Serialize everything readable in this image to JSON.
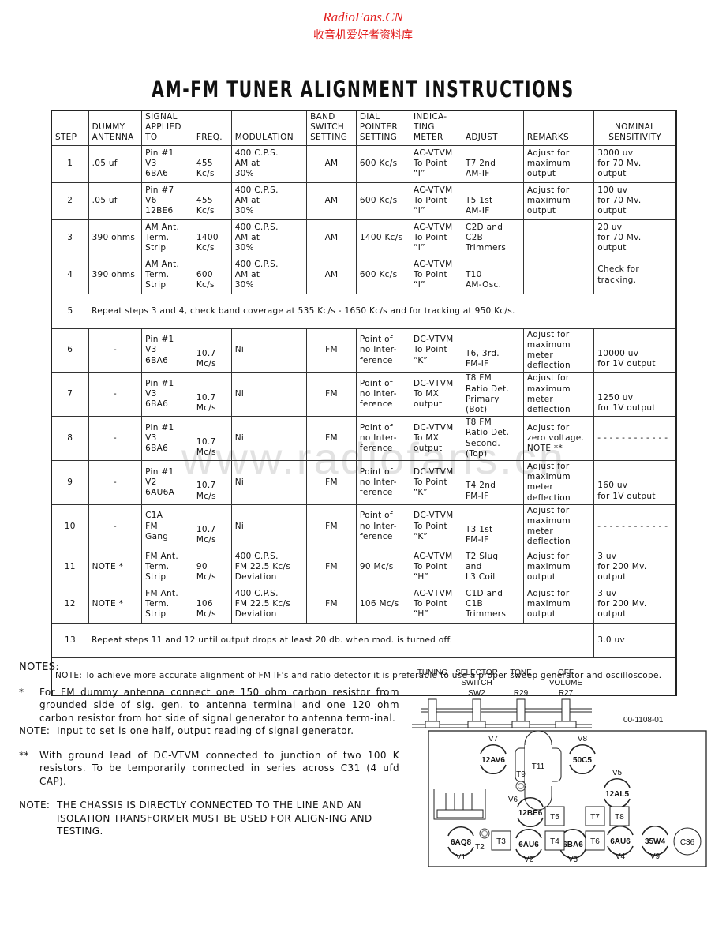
{
  "watermark": {
    "site": "RadioFans.CN",
    "subtitle": "收音机爱好者资料库",
    "background": "www.radiofans.cn",
    "color": "#e21b1b"
  },
  "title": "AM-FM TUNER ALIGNMENT INSTRUCTIONS",
  "table": {
    "headers": [
      "STEP",
      "DUMMY ANTENNA",
      "SIGNAL APPLIED TO",
      "FREQ.",
      "MODULATION",
      "BAND SWITCH SETTING",
      "DIAL POINTER SETTING",
      "INDICA-TING METER",
      "ADJUST",
      "REMARKS",
      "NOMINAL SENSITIVITY"
    ],
    "header_lines": [
      [
        "STEP"
      ],
      [
        "DUMMY",
        "ANTENNA"
      ],
      [
        "SIGNAL",
        "APPLIED",
        "TO"
      ],
      [
        "FREQ."
      ],
      [
        "MODULATION"
      ],
      [
        "BAND",
        "SWITCH",
        "SETTING"
      ],
      [
        "DIAL",
        "POINTER",
        "SETTING"
      ],
      [
        "INDICA-",
        "TING",
        "METER"
      ],
      [
        "ADJUST"
      ],
      [
        "REMARKS"
      ],
      [
        "NOMINAL",
        "SENSITIVITY"
      ]
    ],
    "rows": [
      {
        "step": "1",
        "antenna": ".05 uf",
        "signal": [
          "Pin #1",
          "V3",
          "6BA6"
        ],
        "freq": [
          "455",
          "Kc/s"
        ],
        "modulation": [
          "400 C.P.S.",
          "AM at",
          "30%"
        ],
        "band": "AM",
        "dial": "600 Kc/s",
        "meter": [
          "AC-VTVM",
          "To Point",
          "“I”"
        ],
        "adjust": [
          "T7 2nd",
          "AM-IF"
        ],
        "remarks": [
          "Adjust for",
          "maximum output"
        ],
        "sensitivity": [
          "3000 uv",
          "for 70 Mv. output"
        ]
      },
      {
        "step": "2",
        "antenna": ".05 uf",
        "signal": [
          "Pin #7",
          "V6",
          "12BE6"
        ],
        "freq": [
          "455",
          "Kc/s"
        ],
        "modulation": [
          "400 C.P.S.",
          "AM at",
          "30%"
        ],
        "band": "AM",
        "dial": "600 Kc/s",
        "meter": [
          "AC-VTVM",
          "To Point",
          "“I”"
        ],
        "adjust": [
          "T5 1st",
          "AM-IF"
        ],
        "remarks": [
          "Adjust for",
          "maximum output"
        ],
        "sensitivity": [
          "100 uv",
          "for 70 Mv. output"
        ]
      },
      {
        "step": "3",
        "antenna": "390 ohms",
        "signal": [
          "AM Ant.",
          "Term.",
          "Strip"
        ],
        "freq": [
          "1400",
          "Kc/s"
        ],
        "modulation": [
          "400 C.P.S.",
          "AM at",
          "30%"
        ],
        "band": "AM",
        "dial": "1400 Kc/s",
        "meter": [
          "AC-VTVM",
          "To Point",
          "“I”"
        ],
        "adjust": [
          "C2D and C2B",
          "Trimmers"
        ],
        "remarks": [],
        "sensitivity": [
          "20 uv",
          "for 70 Mv. output"
        ]
      },
      {
        "step": "4",
        "antenna": "390 ohms",
        "signal": [
          "AM Ant.",
          "Term.",
          "Strip"
        ],
        "freq": [
          "600",
          "Kc/s"
        ],
        "modulation": [
          "400 C.P.S.",
          "AM at",
          "30%"
        ],
        "band": "AM",
        "dial": "600 Kc/s",
        "meter": [
          "AC-VTVM",
          "To Point",
          "“I”"
        ],
        "adjust": [
          "T10",
          "AM-Osc."
        ],
        "remarks": [],
        "sensitivity": [
          "Check for tracking."
        ]
      },
      {
        "step": "5",
        "span_text": "Repeat steps 3 and 4, check band coverage at 535 Kc/s - 1650 Kc/s and for tracking at 950 Kc/s."
      },
      {
        "step": "6",
        "antenna": "-",
        "signal": [
          "Pin #1",
          "V3",
          "6BA6"
        ],
        "freq": [
          "10.7",
          "Mc/s"
        ],
        "modulation": [
          "Nil"
        ],
        "band": "FM",
        "dial": [
          "Point of",
          "no Inter-",
          "ference"
        ],
        "meter": [
          "DC-VTVM",
          "To Point",
          "“K”"
        ],
        "adjust": [
          "T6, 3rd.",
          "FM-IF"
        ],
        "remarks": [
          "Adjust for",
          "maximum meter",
          "deflection"
        ],
        "sensitivity": [
          "10000 uv",
          "for 1V output"
        ]
      },
      {
        "step": "7",
        "antenna": "-",
        "signal": [
          "Pin #1",
          "V3",
          "6BA6"
        ],
        "freq": [
          "10.7",
          "Mc/s"
        ],
        "modulation": [
          "Nil"
        ],
        "band": "FM",
        "dial": [
          "Point of",
          "no Inter-",
          "ference"
        ],
        "meter": [
          "DC-VTVM",
          "To MX",
          "output"
        ],
        "adjust": [
          "T8 FM",
          "Ratio Det.",
          "Primary (Bot)"
        ],
        "remarks": [
          "Adjust for",
          "maximum meter",
          "deflection"
        ],
        "sensitivity": [
          "1250 uv",
          "for 1V output"
        ]
      },
      {
        "step": "8",
        "antenna": "-",
        "signal": [
          "Pin #1",
          "V3",
          "6BA6"
        ],
        "freq": [
          "10.7",
          "Mc/s"
        ],
        "modulation": [
          "Nil"
        ],
        "band": "FM",
        "dial": [
          "Point of",
          "no Inter-",
          "ference"
        ],
        "meter": [
          "DC-VTVM",
          "To MX",
          "output"
        ],
        "adjust": [
          "T8 FM",
          "Ratio Det.",
          "Second. (Top)"
        ],
        "remarks": [
          "Adjust for",
          "zero voltage.",
          "NOTE **"
        ],
        "sensitivity": [
          "- - - - - - - - - - - -"
        ]
      },
      {
        "step": "9",
        "antenna": "-",
        "signal": [
          "Pin #1",
          "V2",
          "6AU6A"
        ],
        "freq": [
          "10.7",
          "Mc/s"
        ],
        "modulation": [
          "Nil"
        ],
        "band": "FM",
        "dial": [
          "Point of",
          "no Inter-",
          "ference"
        ],
        "meter": [
          "DC-VTVM",
          "To Point",
          "“K”"
        ],
        "adjust": [
          "T4 2nd",
          "FM-IF"
        ],
        "remarks": [
          "Adjust for",
          "maximum meter",
          "deflection"
        ],
        "sensitivity": [
          "160 uv",
          "for 1V output"
        ]
      },
      {
        "step": "10",
        "antenna": "-",
        "signal": [
          "C1A",
          "FM",
          "Gang"
        ],
        "freq": [
          "10.7",
          "Mc/s"
        ],
        "modulation": [
          "Nil"
        ],
        "band": "FM",
        "dial": [
          "Point of",
          "no Inter-",
          "ference"
        ],
        "meter": [
          "DC-VTVM",
          "To Point",
          "“K”"
        ],
        "adjust": [
          "T3 1st",
          "FM-IF"
        ],
        "remarks": [
          "Adjust for",
          "maximum meter",
          "deflection"
        ],
        "sensitivity": [
          "- - - - - - - - - - - -"
        ]
      },
      {
        "step": "11",
        "antenna": "NOTE *",
        "signal": [
          "FM Ant.",
          "Term.",
          "Strip"
        ],
        "freq": [
          "90",
          "Mc/s"
        ],
        "modulation": [
          "400 C.P.S.",
          "FM 22.5 Kc/s",
          "Deviation"
        ],
        "band": "FM",
        "dial": [
          "90 Mc/s"
        ],
        "meter": [
          "AC-VTVM",
          "To Point",
          "“H”"
        ],
        "adjust": [
          "T2 Slug",
          "and",
          "L3 Coil"
        ],
        "remarks": [
          "Adjust for",
          "maximum output"
        ],
        "sensitivity": [
          "3 uv",
          "for 200 Mv. output"
        ]
      },
      {
        "step": "12",
        "antenna": "NOTE *",
        "signal": [
          "FM Ant.",
          "Term.",
          "Strip"
        ],
        "freq": [
          "106",
          "Mc/s"
        ],
        "modulation": [
          "400 C.P.S.",
          "FM 22.5 Kc/s",
          "Deviation"
        ],
        "band": "FM",
        "dial": [
          "106 Mc/s"
        ],
        "meter": [
          "AC-VTVM",
          "To Point",
          "“H”"
        ],
        "adjust": [
          "C1D and C1B",
          "Trimmers"
        ],
        "remarks": [
          "Adjust for",
          "maximum output"
        ],
        "sensitivity": [
          "3 uv",
          "for 200 Mv. output"
        ]
      },
      {
        "step": "13",
        "span_text": "Repeat steps 11 and 12 until output drops at least 20 db. when mod. is turned off.",
        "sensitivity": [
          "3.0 uv"
        ]
      }
    ],
    "footer_note": "NOTE:  To achieve more accurate alignment of FM IF's and ratio detector it is preferable to use a proper sweep generator and oscilloscope."
  },
  "notes": {
    "heading": "NOTES:",
    "items": [
      {
        "marker": "*",
        "text": "For FM dummy antenna connect one 150 ohm carbon resistor from grounded side of sig. gen. to antenna terminal and one 120 ohm carbon resistor from hot side of signal generator to antenna term-inal."
      },
      {
        "marker": "NOTE:",
        "text": "Input to set is one half, output reading of signal generator."
      },
      {
        "marker": "**",
        "text": "With ground lead of DC-VTVM connected to junction of two 100 K resistors.  To be temporarily connected in series across C31 (4 ufd CAP)."
      },
      {
        "marker": "NOTE:",
        "text": "THE CHASSIS IS DIRECTLY CONNECTED TO THE LINE AND AN ISOLATION TRANSFORMER MUST BE USED FOR ALIGN-ING AND TESTING."
      }
    ]
  },
  "diagram": {
    "part_number": "00-1108-01",
    "controls": [
      {
        "lines": [
          "TUNING"
        ]
      },
      {
        "lines": [
          "SELECTOR",
          "SWITCH",
          "SW2"
        ]
      },
      {
        "lines": [
          "TONE",
          "",
          "R29"
        ]
      },
      {
        "lines": [
          "OFF",
          "VOLUME",
          "R27"
        ]
      }
    ],
    "tubes": [
      {
        "ref": "V7",
        "type": "12AV6"
      },
      {
        "ref": "V8",
        "type": "50C5"
      },
      {
        "ref": "V5",
        "type": "12AL5"
      },
      {
        "ref": "V6",
        "type": "12BE6"
      },
      {
        "ref": "V1",
        "type": "6AQ8"
      },
      {
        "ref": "V2",
        "type": "6AU6"
      },
      {
        "ref": "V3",
        "type": "6BA6"
      },
      {
        "ref": "V4",
        "type": "6AU6"
      },
      {
        "ref": "V9",
        "type": "35W4"
      }
    ],
    "transformers": [
      "T11",
      "T9",
      "T2",
      "T3",
      "T4",
      "T5",
      "T6",
      "T7",
      "T8"
    ],
    "capacitor": "C36"
  }
}
